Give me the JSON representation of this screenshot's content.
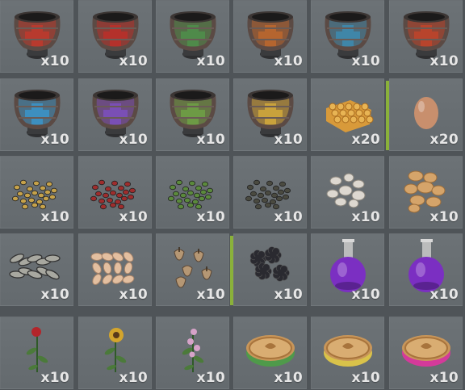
{
  "inventory": {
    "slots": [
      {
        "icon": "planter-red-cross-icon",
        "qty": "x10",
        "color": "#b83a2e",
        "kind": "pot"
      },
      {
        "icon": "planter-red-plus-icon",
        "qty": "x10",
        "color": "#b4312b",
        "kind": "pot"
      },
      {
        "icon": "planter-green-tree-icon",
        "qty": "x10",
        "color": "#4f8a4a",
        "kind": "pot"
      },
      {
        "icon": "planter-orange-pattern-icon",
        "qty": "x10",
        "color": "#b5652f",
        "kind": "pot"
      },
      {
        "icon": "planter-blue-hexagon-icon",
        "qty": "x10",
        "color": "#3f86a8",
        "kind": "pot"
      },
      {
        "icon": "planter-red-flame-icon",
        "qty": "x10",
        "color": "#b8442c",
        "kind": "pot"
      },
      {
        "icon": "planter-blue-snowflake-icon",
        "qty": "x10",
        "color": "#3d8fbf",
        "kind": "pot"
      },
      {
        "icon": "planter-purple-square-icon",
        "qty": "x10",
        "color": "#7a4fb5",
        "kind": "pot"
      },
      {
        "icon": "planter-green-splat-icon",
        "qty": "x10",
        "color": "#6d9a45",
        "kind": "pot"
      },
      {
        "icon": "planter-yellow-radiation-icon",
        "qty": "x10",
        "color": "#c9a23c",
        "kind": "pot"
      },
      {
        "icon": "honeycomb-icon",
        "qty": "x20",
        "color": "#e8b454",
        "kind": "honeycomb"
      },
      {
        "icon": "egg-icon",
        "qty": "x20",
        "color": "#c88f6d",
        "kind": "egg",
        "condition": true
      },
      {
        "icon": "yellow-seeds-icon",
        "qty": "x10",
        "color": "#c6a24a",
        "kind": "seeds"
      },
      {
        "icon": "red-seeds-icon",
        "qty": "x10",
        "color": "#9e2d2d",
        "kind": "seeds"
      },
      {
        "icon": "green-seeds-icon",
        "qty": "x10",
        "color": "#5b8a3c",
        "kind": "seeds"
      },
      {
        "icon": "dark-seeds-icon",
        "qty": "x10",
        "color": "#4a4a40",
        "kind": "seeds"
      },
      {
        "icon": "white-pebbles-icon",
        "qty": "x10",
        "color": "#ddd8d0",
        "kind": "pebbles"
      },
      {
        "icon": "peanuts-icon",
        "qty": "x10",
        "color": "#d5a46a",
        "kind": "nuts"
      },
      {
        "icon": "sunflower-seeds-icon",
        "qty": "x10",
        "color": "#a8a8a0",
        "kind": "sunseeds"
      },
      {
        "icon": "pumpkin-seeds-icon",
        "qty": "x10",
        "color": "#e3bfa0",
        "kind": "pumpseeds"
      },
      {
        "icon": "bulbs-icon",
        "qty": "x10",
        "color": "#b59774",
        "kind": "bulbs"
      },
      {
        "icon": "blackberries-icon",
        "qty": "x10",
        "color": "#2a2a30",
        "kind": "berries",
        "condition": true
      },
      {
        "icon": "purple-potion-flask-icon",
        "qty": "x10",
        "color": "#7b2fc2",
        "kind": "flask"
      },
      {
        "icon": "purple-potion-flask-icon",
        "qty": "x10",
        "color": "#7b2fc2",
        "kind": "flask"
      },
      {
        "icon": "red-rose-icon",
        "qty": "x10",
        "color": "#b3252a",
        "kind": "rose"
      },
      {
        "icon": "sunflower-icon",
        "qty": "x10",
        "color": "#d4a52c",
        "kind": "sunflower"
      },
      {
        "icon": "pink-flower-stalk-icon",
        "qty": "x10",
        "color": "#d6a3c8",
        "kind": "stalk"
      },
      {
        "icon": "pie-green-icon",
        "qty": "x10",
        "color": "#4f9a4a",
        "kind": "pie"
      },
      {
        "icon": "pie-yellow-icon",
        "qty": "x10",
        "color": "#d9c24a",
        "kind": "pie"
      },
      {
        "icon": "pie-pink-icon",
        "qty": "x10",
        "color": "#d43a9a",
        "kind": "pie"
      }
    ]
  }
}
